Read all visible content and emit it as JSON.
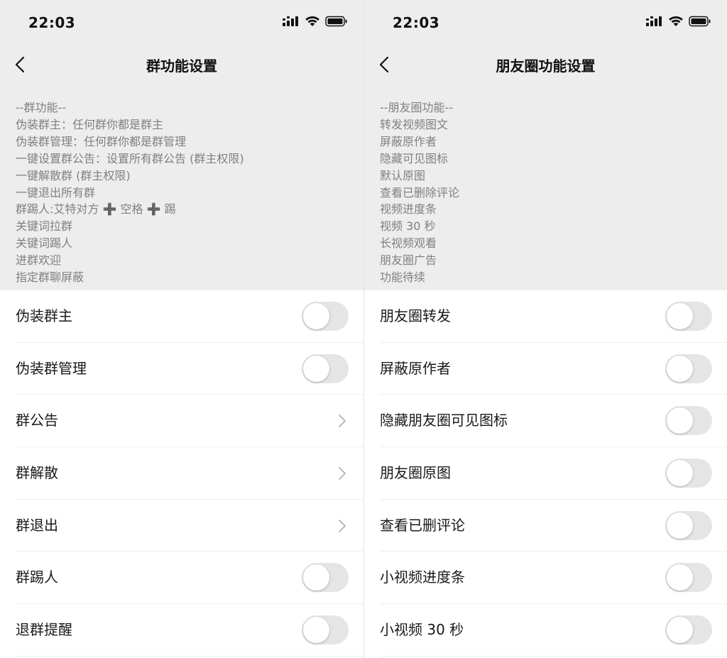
{
  "left": {
    "status": {
      "time": "22:03"
    },
    "nav": {
      "title": "群功能设置"
    },
    "description": [
      "--群功能--",
      "伪装群主：任何群你都是群主",
      "伪装群管理：任何群你都是群管理",
      "一键设置群公告：设置所有群公告 (群主权限)",
      "一键解散群 (群主权限)",
      "一键退出所有群",
      "群踢人:艾特对方 ➕ 空格 ➕ 踢",
      "关键词拉群",
      "关键词踢人",
      "进群欢迎",
      "指定群聊屏蔽"
    ],
    "rows": [
      {
        "label": "伪装群主",
        "type": "toggle",
        "on": false
      },
      {
        "label": "伪装群管理",
        "type": "toggle",
        "on": false
      },
      {
        "label": "群公告",
        "type": "link"
      },
      {
        "label": "群解散",
        "type": "link"
      },
      {
        "label": "群退出",
        "type": "link"
      },
      {
        "label": "群踢人",
        "type": "toggle",
        "on": false
      },
      {
        "label": "退群提醒",
        "type": "toggle",
        "on": false
      }
    ]
  },
  "right": {
    "status": {
      "time": "22:03"
    },
    "nav": {
      "title": "朋友圈功能设置"
    },
    "description": [
      "--朋友圈功能--",
      "转发视频图文",
      "屏蔽原作者",
      "隐藏可见图标",
      "默认原图",
      "查看已删除评论",
      "视频进度条",
      "视频 30 秒",
      "长视频观看",
      "朋友圈广告",
      "功能待续"
    ],
    "rows": [
      {
        "label": "朋友圈转发",
        "type": "toggle",
        "on": false
      },
      {
        "label": "屏蔽原作者",
        "type": "toggle",
        "on": false
      },
      {
        "label": "隐藏朋友圈可见图标",
        "type": "toggle",
        "on": false
      },
      {
        "label": "朋友圈原图",
        "type": "toggle",
        "on": false
      },
      {
        "label": "查看已删评论",
        "type": "toggle",
        "on": false
      },
      {
        "label": "小视频进度条",
        "type": "toggle",
        "on": false
      },
      {
        "label": "小视频 30 秒",
        "type": "toggle",
        "on": false
      }
    ]
  },
  "icons": {
    "status": [
      "cellular-signal-icon",
      "wifi-icon",
      "battery-icon"
    ],
    "back": "back-arrow-icon",
    "row_link": "chevron-right-icon"
  },
  "colors": {
    "background": "#ededed",
    "list_background": "#ffffff",
    "description_text": "#808080",
    "toggle_off": "#e5e5e5"
  }
}
